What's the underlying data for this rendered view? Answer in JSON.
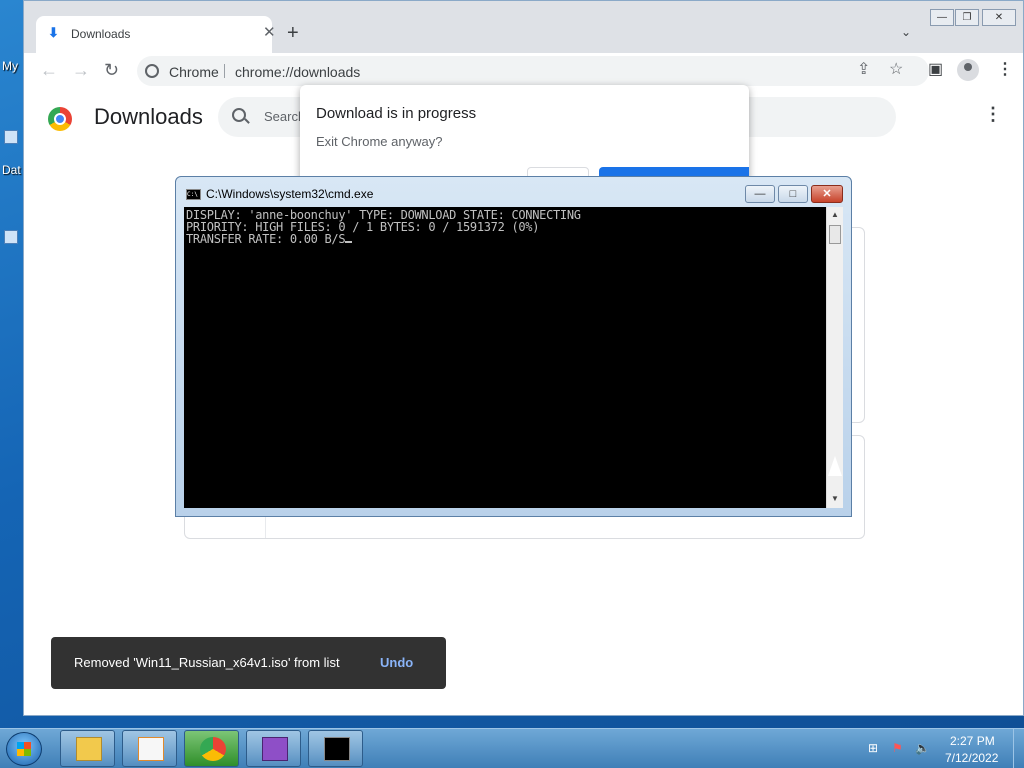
{
  "desktop": {
    "labels": [
      "My",
      "Dat"
    ]
  },
  "chrome": {
    "tab": {
      "title": "Downloads",
      "close": "✕"
    },
    "new_tab": "+",
    "tab_search": "⌄",
    "window_controls": {
      "minimize": "—",
      "restore": "❐",
      "close": "✕"
    },
    "toolbar": {
      "back": "←",
      "forward": "→",
      "reload": "↻",
      "site_label": "Chrome",
      "url": "chrome://downloads",
      "share_icon": "⇪",
      "star_icon": "☆",
      "sidepanel_icon": "▣",
      "menu_icon": "⋮"
    },
    "page": {
      "title": "Downloads",
      "search_placeholder": "Search",
      "menu_icon": "⋮"
    }
  },
  "dialog": {
    "title": "Download is in progress",
    "message": "Exit Chrome anyway?"
  },
  "toast": {
    "message": "Removed 'Win11_Russian_x64v1.iso' from list",
    "undo": "Undo"
  },
  "cmd": {
    "title": "C:\\Windows\\system32\\cmd.exe",
    "icon_text": "C:\\",
    "buttons": {
      "minimize": "—",
      "maximize": "□",
      "close": "✕"
    },
    "lines": [
      "DISPLAY: 'anne-boonchuy' TYPE: DOWNLOAD STATE: CONNECTING",
      "PRIORITY: HIGH FILES: 0 / 1 BYTES: 0 / 1591372 (0%)",
      "TRANSFER RATE: 0.00 B/S"
    ],
    "scroll_up": "▲",
    "scroll_down": "▼"
  },
  "taskbar": {
    "apps": [
      "file-explorer",
      "media-player",
      "chrome",
      "help",
      "cmd"
    ],
    "tray": {
      "network": "⊞",
      "flag": "⚑",
      "volume": "🔈"
    },
    "time": "2:27 PM",
    "date": "7/12/2022"
  },
  "colors": {
    "chrome_blue": "#1a73e8",
    "toast_bg": "#323232",
    "toast_action": "#8ab4f8",
    "console_bg": "#000000",
    "console_text": "#c0c0c0"
  }
}
